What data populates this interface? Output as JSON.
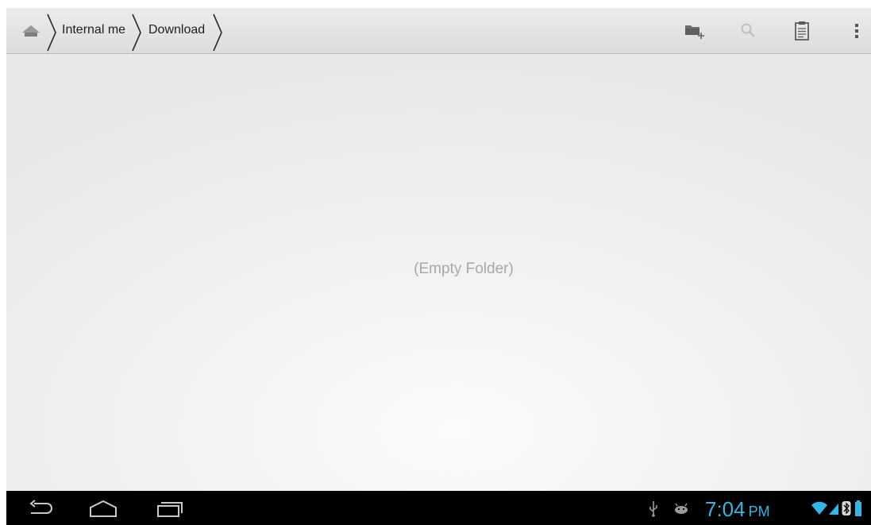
{
  "breadcrumb": {
    "home_icon": "home-icon",
    "items": [
      {
        "label": "Internal me"
      },
      {
        "label": "Download"
      }
    ]
  },
  "toolbar": {
    "icons": [
      "new-folder-icon",
      "search-icon",
      "clipboard-icon",
      "overflow-menu-icon"
    ]
  },
  "content": {
    "empty_message": "(Empty Folder)"
  },
  "system_bar": {
    "nav_icons": [
      "back-icon",
      "home-icon",
      "recent-apps-icon"
    ],
    "status_icons": [
      "usb-icon",
      "android-debug-icon",
      "wifi-icon",
      "signal-icon",
      "bluetooth-icon",
      "battery-icon"
    ],
    "time": "7:04",
    "ampm": "PM",
    "clock_color": "#33b5e5"
  }
}
